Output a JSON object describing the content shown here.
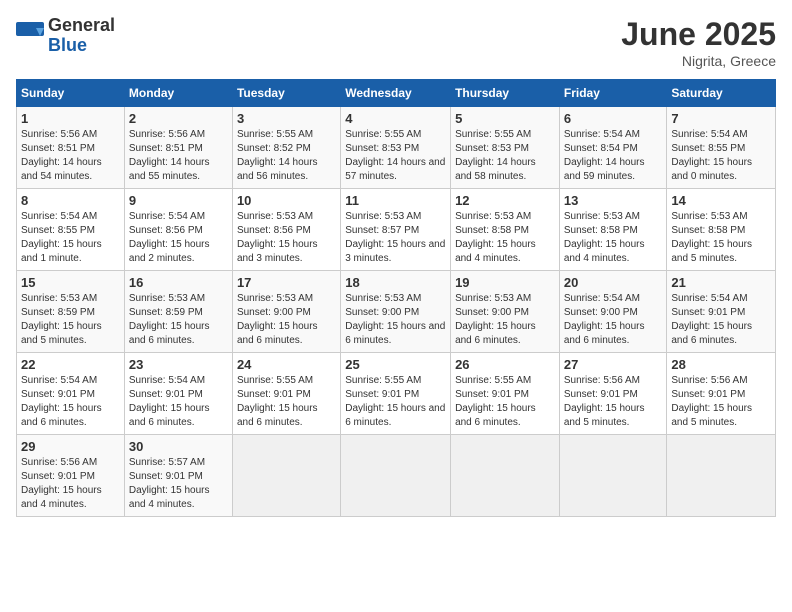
{
  "header": {
    "logo_general": "General",
    "logo_blue": "Blue",
    "month_title": "June 2025",
    "location": "Nigrita, Greece"
  },
  "weekdays": [
    "Sunday",
    "Monday",
    "Tuesday",
    "Wednesday",
    "Thursday",
    "Friday",
    "Saturday"
  ],
  "weeks": [
    [
      {
        "day": "1",
        "sunrise": "5:56 AM",
        "sunset": "8:51 PM",
        "daylight": "14 hours and 54 minutes."
      },
      {
        "day": "2",
        "sunrise": "5:56 AM",
        "sunset": "8:51 PM",
        "daylight": "14 hours and 55 minutes."
      },
      {
        "day": "3",
        "sunrise": "5:55 AM",
        "sunset": "8:52 PM",
        "daylight": "14 hours and 56 minutes."
      },
      {
        "day": "4",
        "sunrise": "5:55 AM",
        "sunset": "8:53 PM",
        "daylight": "14 hours and 57 minutes."
      },
      {
        "day": "5",
        "sunrise": "5:55 AM",
        "sunset": "8:53 PM",
        "daylight": "14 hours and 58 minutes."
      },
      {
        "day": "6",
        "sunrise": "5:54 AM",
        "sunset": "8:54 PM",
        "daylight": "14 hours and 59 minutes."
      },
      {
        "day": "7",
        "sunrise": "5:54 AM",
        "sunset": "8:55 PM",
        "daylight": "15 hours and 0 minutes."
      }
    ],
    [
      {
        "day": "8",
        "sunrise": "5:54 AM",
        "sunset": "8:55 PM",
        "daylight": "15 hours and 1 minute."
      },
      {
        "day": "9",
        "sunrise": "5:54 AM",
        "sunset": "8:56 PM",
        "daylight": "15 hours and 2 minutes."
      },
      {
        "day": "10",
        "sunrise": "5:53 AM",
        "sunset": "8:56 PM",
        "daylight": "15 hours and 3 minutes."
      },
      {
        "day": "11",
        "sunrise": "5:53 AM",
        "sunset": "8:57 PM",
        "daylight": "15 hours and 3 minutes."
      },
      {
        "day": "12",
        "sunrise": "5:53 AM",
        "sunset": "8:58 PM",
        "daylight": "15 hours and 4 minutes."
      },
      {
        "day": "13",
        "sunrise": "5:53 AM",
        "sunset": "8:58 PM",
        "daylight": "15 hours and 4 minutes."
      },
      {
        "day": "14",
        "sunrise": "5:53 AM",
        "sunset": "8:58 PM",
        "daylight": "15 hours and 5 minutes."
      }
    ],
    [
      {
        "day": "15",
        "sunrise": "5:53 AM",
        "sunset": "8:59 PM",
        "daylight": "15 hours and 5 minutes."
      },
      {
        "day": "16",
        "sunrise": "5:53 AM",
        "sunset": "8:59 PM",
        "daylight": "15 hours and 6 minutes."
      },
      {
        "day": "17",
        "sunrise": "5:53 AM",
        "sunset": "9:00 PM",
        "daylight": "15 hours and 6 minutes."
      },
      {
        "day": "18",
        "sunrise": "5:53 AM",
        "sunset": "9:00 PM",
        "daylight": "15 hours and 6 minutes."
      },
      {
        "day": "19",
        "sunrise": "5:53 AM",
        "sunset": "9:00 PM",
        "daylight": "15 hours and 6 minutes."
      },
      {
        "day": "20",
        "sunrise": "5:54 AM",
        "sunset": "9:00 PM",
        "daylight": "15 hours and 6 minutes."
      },
      {
        "day": "21",
        "sunrise": "5:54 AM",
        "sunset": "9:01 PM",
        "daylight": "15 hours and 6 minutes."
      }
    ],
    [
      {
        "day": "22",
        "sunrise": "5:54 AM",
        "sunset": "9:01 PM",
        "daylight": "15 hours and 6 minutes."
      },
      {
        "day": "23",
        "sunrise": "5:54 AM",
        "sunset": "9:01 PM",
        "daylight": "15 hours and 6 minutes."
      },
      {
        "day": "24",
        "sunrise": "5:55 AM",
        "sunset": "9:01 PM",
        "daylight": "15 hours and 6 minutes."
      },
      {
        "day": "25",
        "sunrise": "5:55 AM",
        "sunset": "9:01 PM",
        "daylight": "15 hours and 6 minutes."
      },
      {
        "day": "26",
        "sunrise": "5:55 AM",
        "sunset": "9:01 PM",
        "daylight": "15 hours and 6 minutes."
      },
      {
        "day": "27",
        "sunrise": "5:56 AM",
        "sunset": "9:01 PM",
        "daylight": "15 hours and 5 minutes."
      },
      {
        "day": "28",
        "sunrise": "5:56 AM",
        "sunset": "9:01 PM",
        "daylight": "15 hours and 5 minutes."
      }
    ],
    [
      {
        "day": "29",
        "sunrise": "5:56 AM",
        "sunset": "9:01 PM",
        "daylight": "15 hours and 4 minutes."
      },
      {
        "day": "30",
        "sunrise": "5:57 AM",
        "sunset": "9:01 PM",
        "daylight": "15 hours and 4 minutes."
      },
      null,
      null,
      null,
      null,
      null
    ]
  ]
}
